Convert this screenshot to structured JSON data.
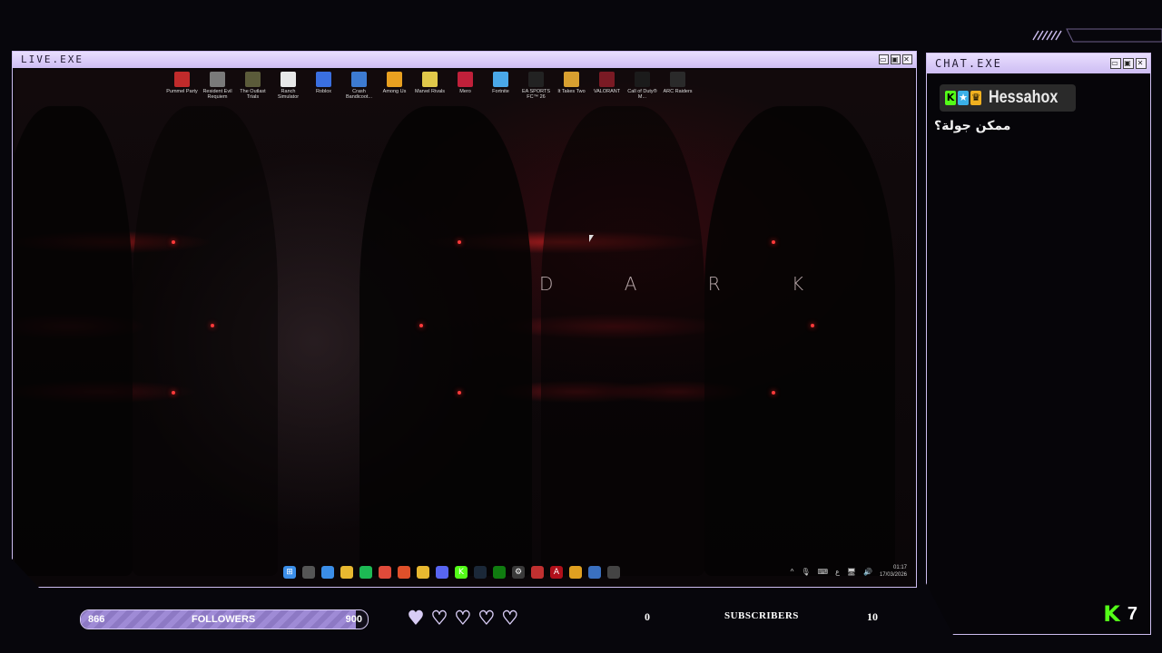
{
  "live_window": {
    "title": "LIVE.EXE",
    "window_buttons": [
      "▭",
      "▣",
      "✕"
    ]
  },
  "desktop": {
    "wallpaper_text": "D A R K",
    "icons": [
      {
        "label": "Pummel Party",
        "icon": "pummel-party-icon",
        "color": "#c02b2b"
      },
      {
        "label": "Resident Evil Requiem",
        "icon": "resident-evil-icon",
        "color": "#7a7a7a"
      },
      {
        "label": "The Outlast Trials",
        "icon": "outlast-icon",
        "color": "#5b5b3a"
      },
      {
        "label": "Ranch Simulator",
        "icon": "ranch-sim-icon",
        "color": "#e8e8e8"
      },
      {
        "label": "Roblox",
        "icon": "roblox-icon",
        "color": "#3a6fe0"
      },
      {
        "label": "Crash Bandicoot...",
        "icon": "crash-icon",
        "color": "#3d7bd1"
      },
      {
        "label": "Among Us",
        "icon": "among-us-icon",
        "color": "#e8a020"
      },
      {
        "label": "Marvel Rivals",
        "icon": "marvel-rivals-icon",
        "color": "#e0c84a"
      },
      {
        "label": "Mero",
        "icon": "mero-icon",
        "color": "#c0203a"
      },
      {
        "label": "Fortnite",
        "icon": "fortnite-icon",
        "color": "#4aa8e8"
      },
      {
        "label": "EA SPORTS FC™ 26",
        "icon": "ea-fc-icon",
        "color": "#222222"
      },
      {
        "label": "It Takes Two",
        "icon": "it-takes-two-icon",
        "color": "#d8a030"
      },
      {
        "label": "VALORANT",
        "icon": "valorant-icon",
        "color": "#7a1a24"
      },
      {
        "label": "Call of Duty® M...",
        "icon": "cod-icon",
        "color": "#1b1b1b"
      },
      {
        "label": "ARC Raiders",
        "icon": "arc-raiders-icon",
        "color": "#2a2a2a"
      }
    ]
  },
  "taskbar": {
    "icons": [
      {
        "name": "windows-start-icon",
        "color": "#3b8ee8",
        "glyph": "⊞"
      },
      {
        "name": "search-icon",
        "color": "#555555",
        "glyph": ""
      },
      {
        "name": "task-view-icon",
        "color": "#3b8ee8",
        "glyph": ""
      },
      {
        "name": "file-explorer-icon",
        "color": "#e8b830",
        "glyph": ""
      },
      {
        "name": "spotify-icon",
        "color": "#1db954",
        "glyph": ""
      },
      {
        "name": "chrome-icon",
        "color": "#e04a3a",
        "glyph": ""
      },
      {
        "name": "brave-icon",
        "color": "#e0502a",
        "glyph": ""
      },
      {
        "name": "yellow-app-icon",
        "color": "#e8b830",
        "glyph": ""
      },
      {
        "name": "discord-icon",
        "color": "#5865f2",
        "glyph": ""
      },
      {
        "name": "kick-icon",
        "color": "#53fc18",
        "glyph": "K"
      },
      {
        "name": "steam-icon",
        "color": "#1b2838",
        "glyph": ""
      },
      {
        "name": "xbox-icon",
        "color": "#107c10",
        "glyph": ""
      },
      {
        "name": "settings-icon",
        "color": "#3a3a3a",
        "glyph": "⚙"
      },
      {
        "name": "record-icon",
        "color": "#c03030",
        "glyph": ""
      },
      {
        "name": "adobe-icon",
        "color": "#b0101a",
        "glyph": "A"
      },
      {
        "name": "arc-icon",
        "color": "#e0a020",
        "glyph": ""
      },
      {
        "name": "window-app-icon",
        "color": "#3a70c0",
        "glyph": ""
      },
      {
        "name": "terminal-icon",
        "color": "#444444",
        "glyph": ""
      }
    ],
    "tray": {
      "chevron": "^",
      "lang": "ع",
      "time": "01:17",
      "date": "17/03/2026"
    }
  },
  "chat_window": {
    "title": "CHAT.EXE",
    "window_buttons": [
      "▭",
      "▣",
      "✕"
    ],
    "username": "Hessahox",
    "message": "ممكن جولة؟",
    "viewer_count": "7",
    "kick_logo": "K"
  },
  "stats": {
    "followers_current": "866",
    "followers_label": "FOLLOWERS",
    "followers_goal": "900",
    "followers_progress": 0.96,
    "hearts_filled": 1,
    "hearts_total": 5,
    "subscribers_current": "0",
    "subscribers_label": "SUBSCRIBERS",
    "subscribers_goal": "10"
  }
}
